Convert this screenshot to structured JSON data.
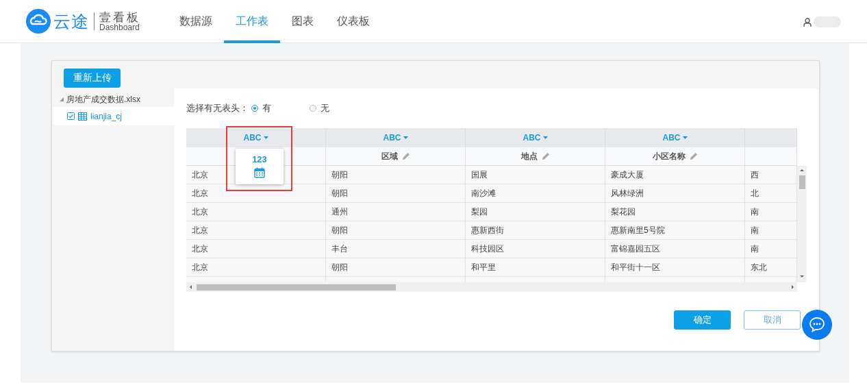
{
  "header": {
    "logo": {
      "brand": "云途",
      "product": "壹看板",
      "subtitle": "Dashboard"
    },
    "tabs": [
      {
        "label": "数据源",
        "selected": false
      },
      {
        "label": "工作表",
        "selected": true
      },
      {
        "label": "图表",
        "selected": false
      },
      {
        "label": "仪表板",
        "selected": false
      }
    ]
  },
  "upload_button": "重新上传",
  "file_tree": [
    {
      "label": "房地产成交数据.xlsx",
      "expanded": true,
      "children": [
        {
          "label": "lianjia_cj",
          "checked": true,
          "selected": true
        }
      ]
    }
  ],
  "header_option": {
    "label": "选择有无表头：",
    "options": [
      {
        "label": "有",
        "selected": true
      },
      {
        "label": "无",
        "selected": false
      }
    ]
  },
  "table": {
    "columns": [
      {
        "type": "ABC",
        "menu_open": true,
        "highlighted": true,
        "type_options": [
          {
            "kind": "number",
            "label": "123"
          },
          {
            "kind": "date"
          }
        ]
      },
      {
        "type": "ABC",
        "name": "区域",
        "menu_open": false,
        "highlighted": false
      },
      {
        "type": "ABC",
        "name": "地点",
        "menu_open": false,
        "highlighted": false
      },
      {
        "type": "ABC",
        "name": "小区名称",
        "menu_open": false,
        "highlighted": false
      },
      {
        "menu_open": false,
        "highlighted": false
      }
    ],
    "rows": [
      [
        "北京",
        "朝阳",
        "国展",
        "豪成大厦",
        "西"
      ],
      [
        "北京",
        "朝阳",
        "南沙滩",
        "风林绿洲",
        "北"
      ],
      [
        "北京",
        "通州",
        "梨园",
        "梨花园",
        "南"
      ],
      [
        "北京",
        "朝阳",
        "惠新西街",
        "惠新南里5号院",
        "南"
      ],
      [
        "北京",
        "丰台",
        "科技园区",
        "富锦嘉园五区",
        "南"
      ],
      [
        "北京",
        "朝阳",
        "和平里",
        "和平街十一区",
        "东北"
      ]
    ]
  },
  "buttons": [
    {
      "label": "确定",
      "kind": "primary"
    },
    {
      "label": "取消",
      "kind": "secondary"
    }
  ]
}
